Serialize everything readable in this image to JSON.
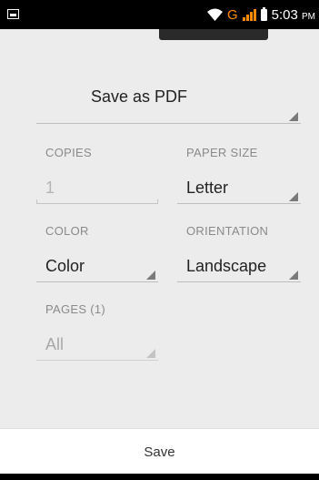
{
  "status_bar": {
    "icons": [
      "gallery-icon",
      "wifi-icon",
      "signal-icon",
      "battery-icon"
    ],
    "network_type": "G",
    "time": "5:03",
    "ampm": "PM",
    "accent_color": "#ff8a00"
  },
  "printer": {
    "label": "Save as PDF"
  },
  "copies": {
    "label": "COPIES",
    "value": "1"
  },
  "paper_size": {
    "label": "PAPER SIZE",
    "value": "Letter"
  },
  "color": {
    "label": "COLOR",
    "value": "Color"
  },
  "orientation": {
    "label": "ORIENTATION",
    "value": "Landscape"
  },
  "pages": {
    "label": "PAGES (1)",
    "value": "All"
  },
  "footer": {
    "save_label": "Save"
  }
}
